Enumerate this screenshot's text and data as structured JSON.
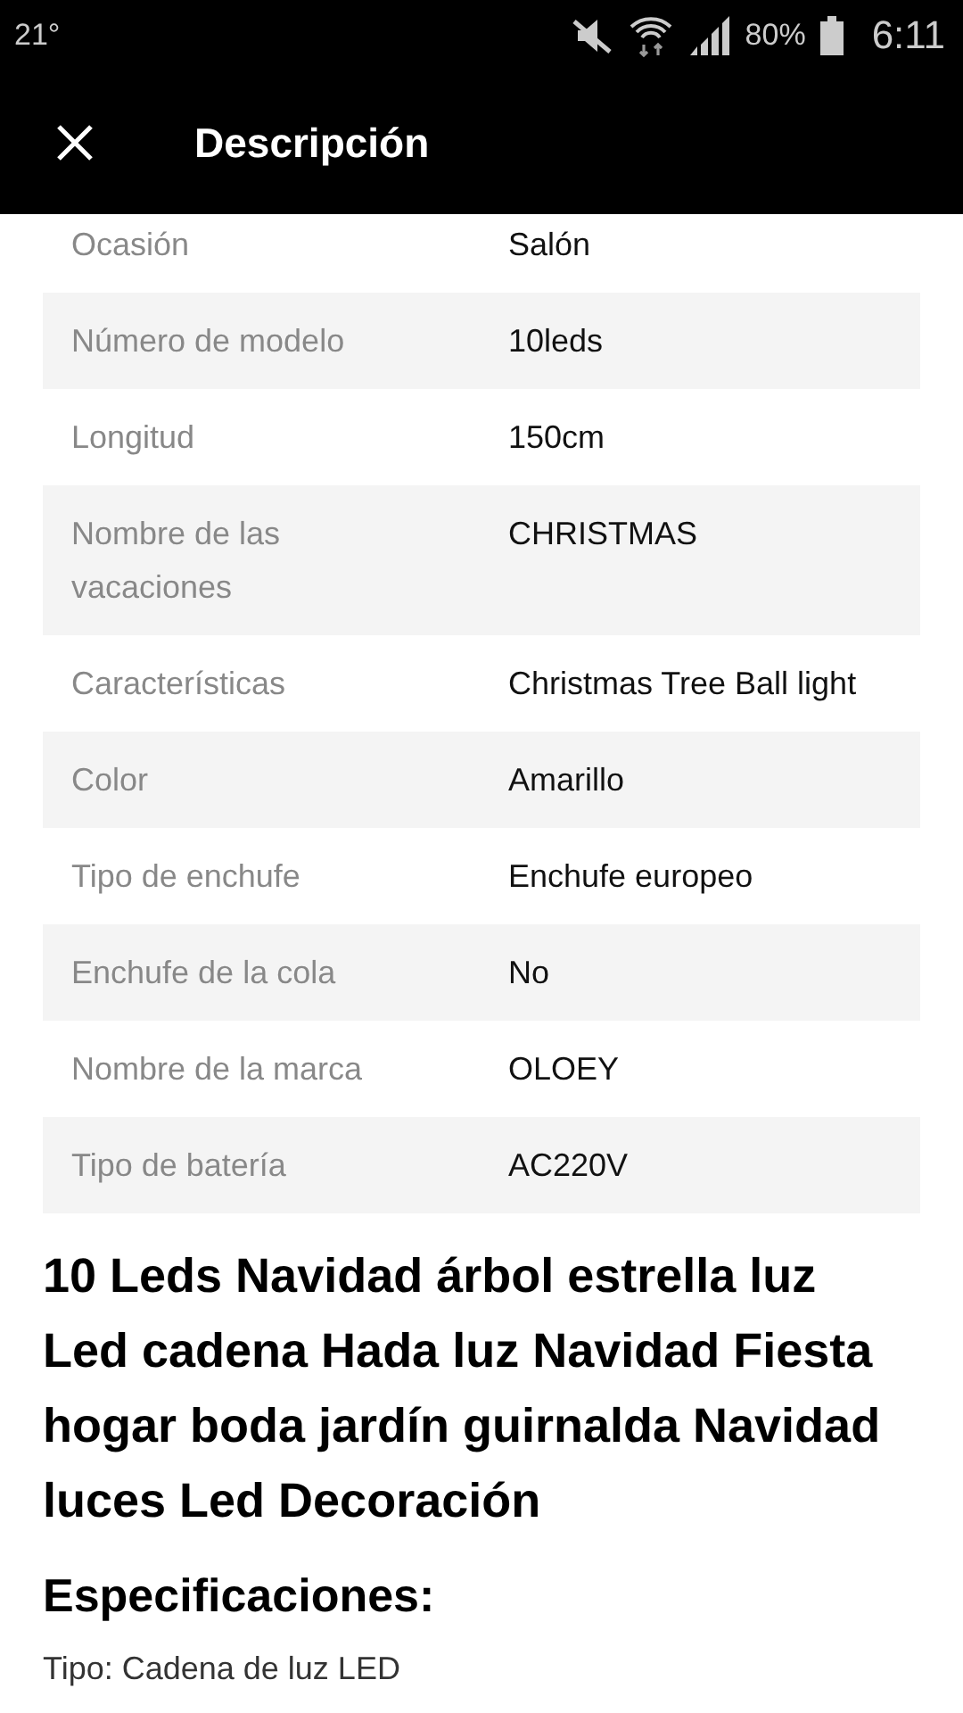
{
  "status_bar": {
    "temperature": "21°",
    "battery": "80%",
    "time": "6:11"
  },
  "header": {
    "title": "Descripción"
  },
  "specs": [
    {
      "label": "Ocasión",
      "value": "Salón"
    },
    {
      "label": "Número de modelo",
      "value": "10leds"
    },
    {
      "label": "Longitud",
      "value": "150cm"
    },
    {
      "label": "Nombre de las vacaciones",
      "value": "CHRISTMAS"
    },
    {
      "label": "Características",
      "value": "Christmas Tree Ball light"
    },
    {
      "label": "Color",
      "value": "Amarillo"
    },
    {
      "label": "Tipo de enchufe",
      "value": "Enchufe europeo"
    },
    {
      "label": "Enchufe de la cola",
      "value": "No"
    },
    {
      "label": "Nombre de la marca",
      "value": "OLOEY"
    },
    {
      "label": "Tipo de batería",
      "value": "AC220V"
    }
  ],
  "product_title": "10 Leds Navidad árbol estrella luz Led cadena Hada luz Navidad Fiesta hogar boda jardín guirnalda Navidad luces Led Decoración",
  "section_heading": "Especificaciones:",
  "spec_line": "Tipo: Cadena de luz LED"
}
